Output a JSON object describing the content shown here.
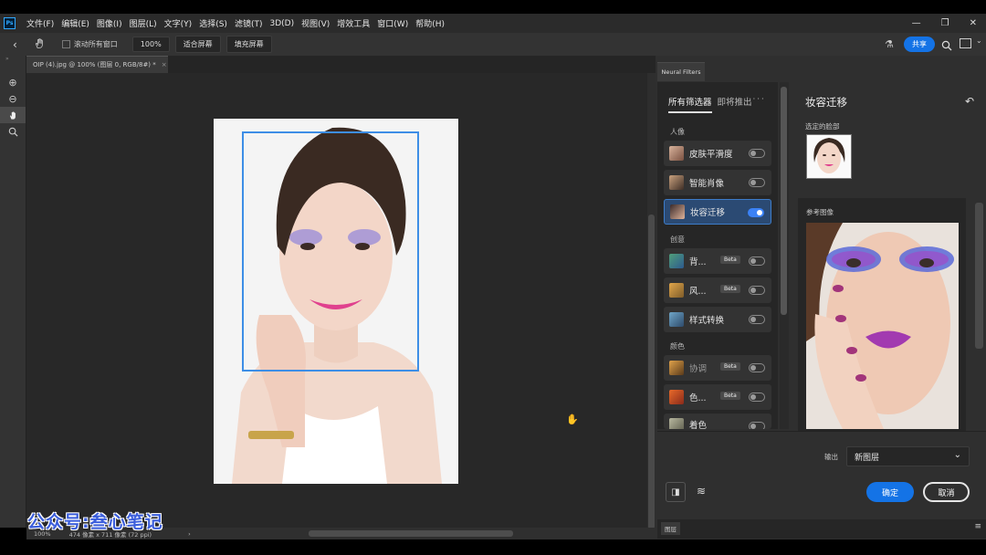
{
  "app": {
    "logo": "Ps"
  },
  "menu": [
    "文件(F)",
    "编辑(E)",
    "图像(I)",
    "图层(L)",
    "文字(Y)",
    "选择(S)",
    "滤镜(T)",
    "3D(D)",
    "视图(V)",
    "增效工具",
    "窗口(W)",
    "帮助(H)"
  ],
  "window_controls": {
    "minimize": "—",
    "restore": "❐",
    "close": "✕"
  },
  "options_bar": {
    "scroll_all_windows": "滚动所有窗口",
    "zoom_value": "100%",
    "fit_screen": "适合屏幕",
    "fill_screen": "填充屏幕",
    "share": "共享"
  },
  "document": {
    "tab_title": "OIP (4).jpg @ 100% (图层 0, RGB/8#) *",
    "tab_close": "×",
    "status_zoom": "100%",
    "status_info": "474 像素 x 711 像素 (72 ppi)",
    "status_arrow": "›"
  },
  "watermark": "公众号:叁心笔记",
  "neural_panel": {
    "tab": "Neural Filters",
    "tabs": [
      "所有筛选器",
      "即将推出"
    ],
    "sections": [
      {
        "label": "人像",
        "items": [
          {
            "name": "皮肤平滑度",
            "beta": false,
            "on": false,
            "active": false
          },
          {
            "name": "智能肖像",
            "beta": false,
            "on": false,
            "active": false
          },
          {
            "name": "妆容迁移",
            "beta": false,
            "on": true,
            "active": true
          }
        ]
      },
      {
        "label": "创意",
        "items": [
          {
            "name": "背...",
            "beta": true,
            "on": false,
            "active": false
          },
          {
            "name": "风...",
            "beta": true,
            "on": false,
            "active": false
          },
          {
            "name": "样式转换",
            "beta": false,
            "on": false,
            "active": false
          }
        ]
      },
      {
        "label": "颜色",
        "items": [
          {
            "name": "协调",
            "beta": true,
            "on": false,
            "active": false
          },
          {
            "name": "色...",
            "beta": true,
            "on": false,
            "active": false
          },
          {
            "name": "着色",
            "beta": false,
            "on": false,
            "active": false
          }
        ]
      }
    ],
    "beta_label": "Beta",
    "settings": {
      "title": "妆容迁移",
      "selected_face_label": "选定的脸部",
      "reference_label": "参考图像"
    },
    "output_label": "输出",
    "output_value": "新图层",
    "ok": "确定",
    "cancel": "取消"
  },
  "layers_panel": {
    "tab": "图层",
    "menu": "≡"
  }
}
